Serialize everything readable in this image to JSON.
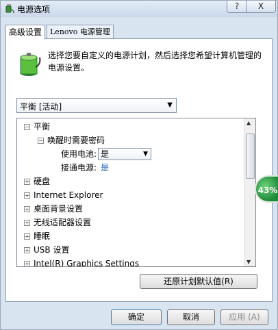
{
  "window": {
    "title": "电源选项",
    "help_label": "?",
    "close_label": "X"
  },
  "tabs": [
    {
      "label": "高级设置"
    },
    {
      "label": "Lenovo 电源管理"
    }
  ],
  "description": "选择您要自定义的电源计划，然后选择您希望计算机管理的电源设置。",
  "plan_select": {
    "value": "平衡 [活动]"
  },
  "tree": {
    "root": "平衡",
    "password_group": "唤醒时需要密码",
    "on_battery_label": "使用电池:",
    "on_battery_value": "是",
    "plugged_in_label": "接通电源:",
    "plugged_in_value": "是",
    "items": [
      "硬盘",
      "Internet Explorer",
      "桌面背景设置",
      "无线适配器设置",
      "睡眠",
      "USB 设置",
      "Intel(R) Graphics Settings"
    ]
  },
  "gauge": {
    "label": "43%"
  },
  "buttons": {
    "restore": "还原计划默认值(R)",
    "ok": "确定",
    "cancel": "取消",
    "apply": "应用 (A)"
  },
  "colors": {
    "accent": "#1e5fb3",
    "gauge_green": "#1d8a3a",
    "underline_red": "#d11a1a"
  }
}
